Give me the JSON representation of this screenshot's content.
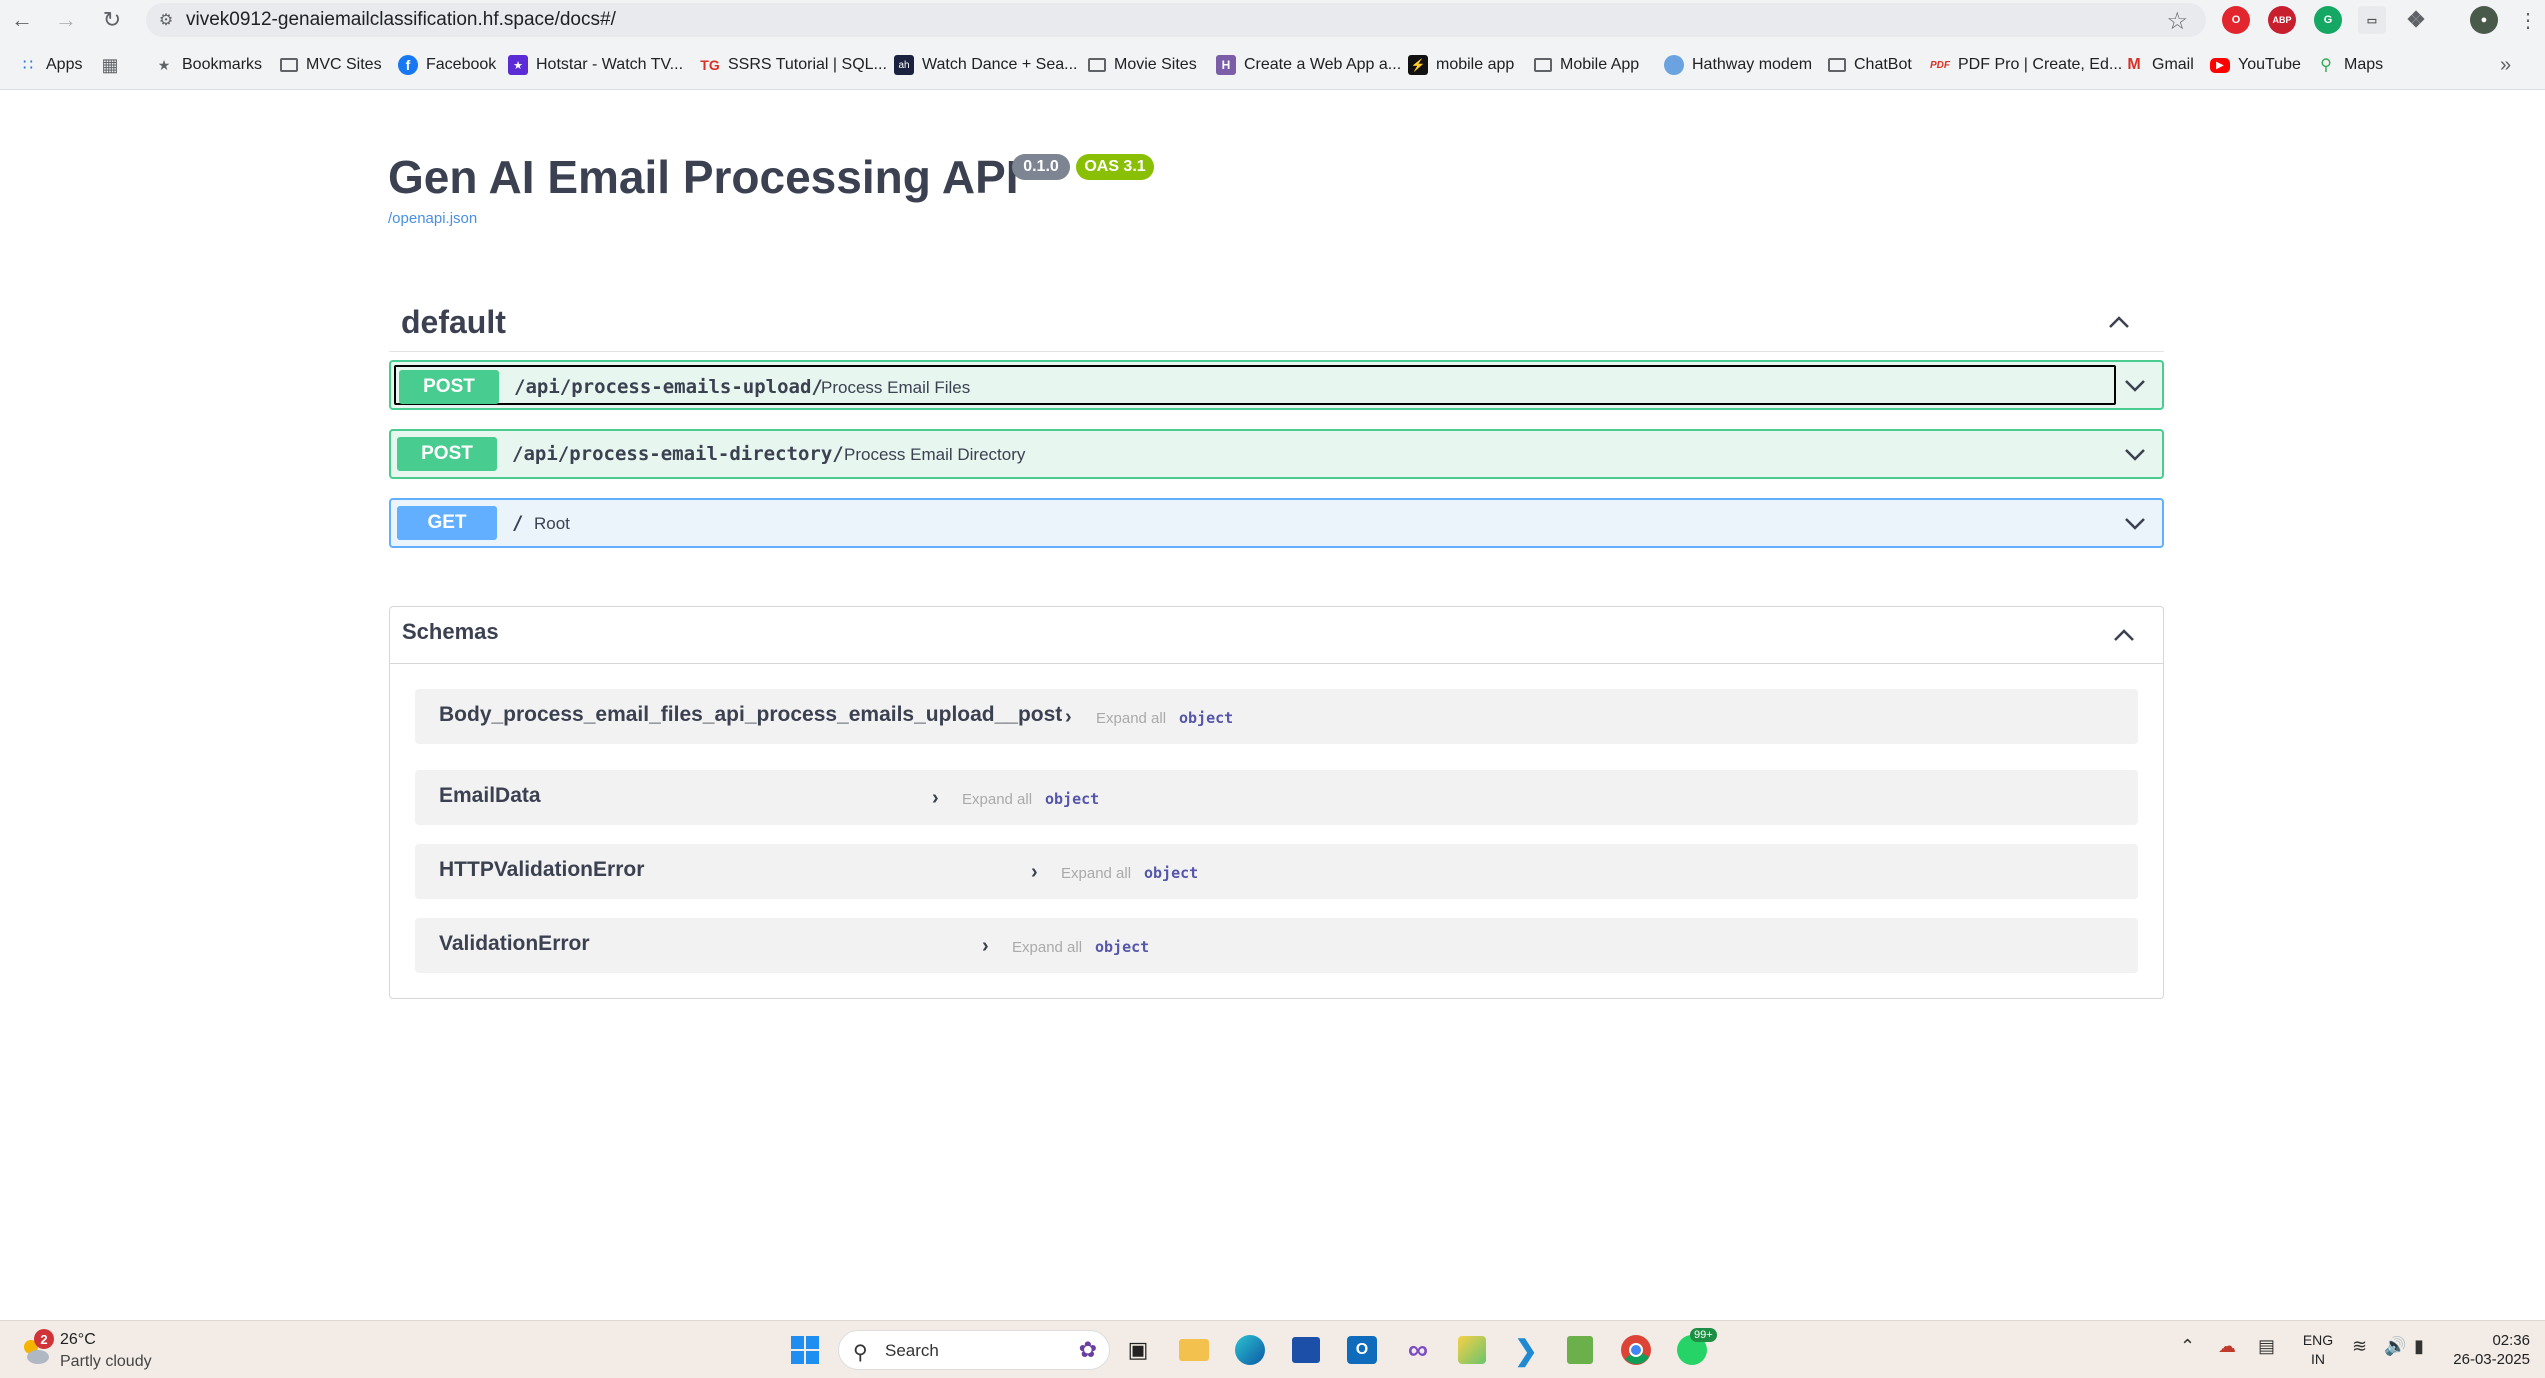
{
  "browser": {
    "url": "vivek0912-genaiemailclassification.hf.space/docs#/",
    "bookmarks": [
      {
        "label": "Apps"
      },
      {
        "label": "Bookmarks"
      },
      {
        "label": "MVC Sites"
      },
      {
        "label": "Facebook"
      },
      {
        "label": "Hotstar - Watch TV..."
      },
      {
        "label": "SSRS Tutorial | SQL..."
      },
      {
        "label": "Watch Dance + Sea..."
      },
      {
        "label": "Movie Sites"
      },
      {
        "label": "Create a Web App a..."
      },
      {
        "label": "mobile app"
      },
      {
        "label": "Mobile App"
      },
      {
        "label": "Hathway modem"
      },
      {
        "label": "ChatBot"
      },
      {
        "label": "PDF Pro | Create, Ed..."
      },
      {
        "label": "Gmail"
      },
      {
        "label": "YouTube"
      },
      {
        "label": "Maps"
      }
    ],
    "extensions": {
      "abp_label": "ABP"
    }
  },
  "swagger": {
    "title": "Gen AI Email Processing API",
    "version_badge": "0.1.0",
    "oas_badge": "OAS 3.1",
    "spec_link": "/openapi.json",
    "tag": {
      "name": "default"
    },
    "operations": [
      {
        "method": "POST",
        "path": "/api/process-emails-upload/",
        "summary": "Process Email Files"
      },
      {
        "method": "POST",
        "path": "/api/process-email-directory/",
        "summary": "Process Email Directory"
      },
      {
        "method": "GET",
        "path": "/",
        "summary": "Root"
      }
    ],
    "schemas": {
      "title": "Schemas",
      "expand_all_label": "Expand all",
      "type_label": "object",
      "models": [
        {
          "name": "Body_process_email_files_api_process_emails_upload__post"
        },
        {
          "name": "EmailData"
        },
        {
          "name": "HTTPValidationError"
        },
        {
          "name": "ValidationError"
        }
      ]
    },
    "colors": {
      "post": "#49cc90",
      "get": "#61affe",
      "text": "#3b4151",
      "version": "#7d8492",
      "oas": "#89bf04"
    }
  },
  "taskbar": {
    "weather": {
      "badge": "2",
      "temp": "26°C",
      "condition": "Partly cloudy"
    },
    "search_label": "Search",
    "chrome_badge": "99+",
    "language": {
      "line1": "ENG",
      "line2": "IN"
    },
    "clock": {
      "time": "02:36",
      "date": "26-03-2025"
    }
  }
}
